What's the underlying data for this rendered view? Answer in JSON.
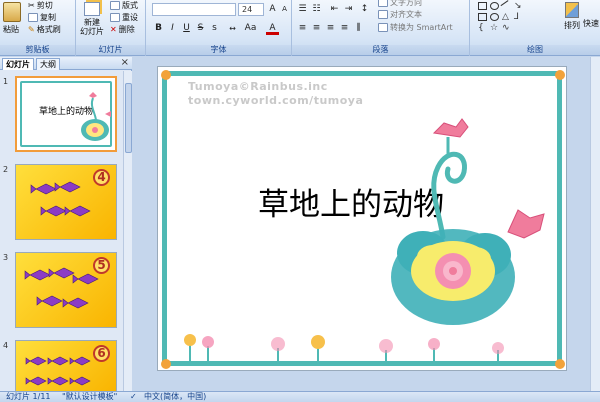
{
  "ribbon": {
    "clipboard": {
      "paste_label": "粘贴",
      "cut_label": "剪切",
      "copy_label": "复制",
      "format_painter_label": "格式刷",
      "group_label": "剪贴板"
    },
    "slides": {
      "new_slide_label": "新建\n幻灯片",
      "layout_label": "版式",
      "reset_label": "重设",
      "delete_label": "删除",
      "group_label": "幻灯片"
    },
    "font": {
      "font_name": "",
      "font_size": "24",
      "group_label": "字体"
    },
    "paragraph": {
      "text_direction_label": "文字方向",
      "align_text_label": "对齐文本",
      "smartart_label": "转换为 SmartArt",
      "group_label": "段落"
    },
    "drawing": {
      "arrange_label": "排列",
      "quick_styles_label": "快速",
      "group_label": "绘图"
    }
  },
  "pane": {
    "tab_slides": "幻灯片",
    "tab_outline": "大纲",
    "close": "×",
    "thumbs": [
      {
        "num": "1",
        "title": "草地上的动物"
      },
      {
        "num": "2",
        "badge": "4"
      },
      {
        "num": "3",
        "badge": "5"
      },
      {
        "num": "4",
        "badge": "6"
      }
    ]
  },
  "slide": {
    "watermark_line1": "Tumoya©Rainbus.inc",
    "watermark_line2": "town.cyworld.com/tumoya",
    "title": "草地上的动物"
  },
  "status": {
    "slide_count": "幻灯片 1/11",
    "theme": "\"默认设计模板\"",
    "language": "中文(简体，中国)"
  },
  "colors": {
    "accent": "#4fb9b4",
    "selection": "#f29c3a",
    "flower_pink": "#f07c9c",
    "fish_bg": "#ffd633"
  }
}
